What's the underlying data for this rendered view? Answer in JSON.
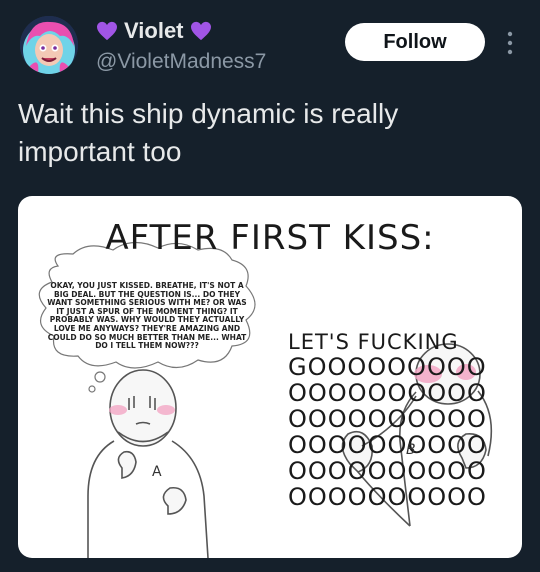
{
  "user": {
    "display_name": "Violet",
    "handle": "@VioletMadness7",
    "name_emoji": "purple-heart-emoji",
    "heart_color": "#a155e6"
  },
  "actions": {
    "follow_label": "Follow",
    "more_icon": "more-vertical-icon"
  },
  "tweet": {
    "text": "Wait this ship dynamic is really important too"
  },
  "media": {
    "title": "AFTER FIRST KISS:",
    "thought_bubble": "OKAY, YOU JUST KISSED. BREATHE, IT'S NOT A BIG DEAL. BUT THE QUESTION IS... DO THEY WANT SOMETHING SERIOUS WITH ME? OR WAS IT JUST A SPUR OF THE MOMENT THING? IT PROBABLY WAS. WHY WOULD THEY ACTUALLY LOVE ME ANYWAYS? THEY'RE AMAZING AND COULD DO SO MUCH BETTER THAN ME... WHAT DO I TELL THEM NOW???",
    "shout_line1": "LET'S FUCKING",
    "shout_lines": [
      "GOOOOOOOOO",
      "OOOOOOOOOO",
      "OOOOOOOOOO",
      "OOOOOOOOOO",
      "OOOOOOOOOO",
      "OOOOOOOOOO"
    ],
    "label_a": "A",
    "label_b": "B"
  },
  "colors": {
    "background": "#15202b",
    "blush": "#f2a6c4"
  }
}
